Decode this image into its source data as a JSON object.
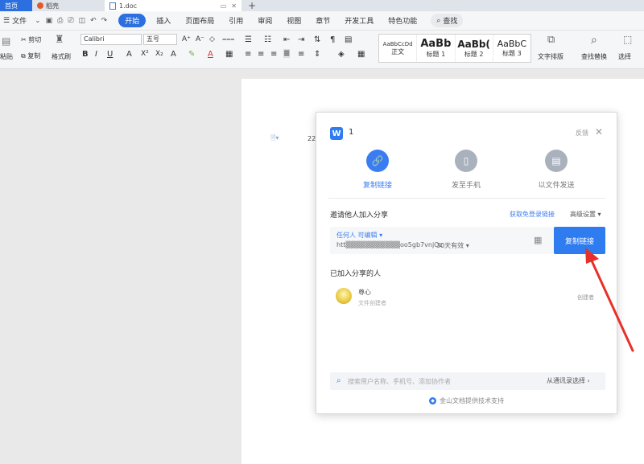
{
  "tabs": {
    "home": "首页",
    "daoke": "稻壳",
    "doc": "1.doc"
  },
  "menu": {
    "file": "文件",
    "items": [
      "开始",
      "插入",
      "页面布局",
      "引用",
      "审阅",
      "视图",
      "章节",
      "开发工具",
      "特色功能"
    ],
    "search": "查找"
  },
  "ribbon": {
    "cut": "剪切",
    "copy": "复制",
    "paste": "粘贴",
    "format_painter": "格式刷",
    "font_name": "Calibri",
    "font_size": "五号",
    "styles": [
      {
        "sample": "AaBbCcDd",
        "name": "正文"
      },
      {
        "sample": "AaBb",
        "name": "标题 1"
      },
      {
        "sample": "AaBb(",
        "name": "标题 2"
      },
      {
        "sample": "AaBbC",
        "name": "标题 3"
      }
    ],
    "text_layout": "文字排版",
    "find_replace": "查找替换",
    "select": "选择"
  },
  "document": {
    "page_number": "22"
  },
  "dialog": {
    "logo": "W",
    "title": "1",
    "feedback": "反馈",
    "modes": [
      {
        "label": "复制链接",
        "icon": "link-icon"
      },
      {
        "label": "发至手机",
        "icon": "phone-icon"
      },
      {
        "label": "以文件发送",
        "icon": "file-icon"
      }
    ],
    "invite_label": "邀请他人加入分享",
    "no_login_link": "获取免登录链接",
    "advanced": "高级设置",
    "permission": "任何人 可编辑",
    "url": "htt▒▒▒▒▒▒▒▒▒▒▒oo5gb7vnjOz",
    "expiry": "30天有效",
    "copy_button": "复制链接",
    "joined_label": "已加入分享的人",
    "member_name": "尊心",
    "member_sub": "文件创建者",
    "member_role": "创建者",
    "search_placeholder": "搜索用户名称、手机号、添加协作者",
    "from_contacts": "从通讯录选择",
    "footer": "金山文档提供技术支持"
  },
  "colors": {
    "accent": "#2f7cf0",
    "arrow": "#e8302a"
  }
}
